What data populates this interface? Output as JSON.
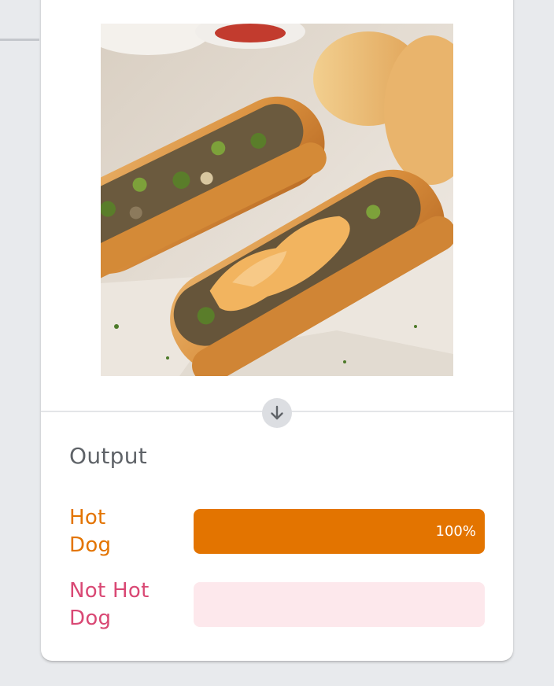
{
  "input": {
    "image_description": "cheesesteak-sandwiches-photo"
  },
  "output": {
    "title": "Output",
    "results": [
      {
        "label_line1": "Hot",
        "label_line2": "Dog",
        "confidence": 1.0,
        "confidence_text": "100%",
        "color": "#e37400",
        "track_color": "#fde7cc"
      },
      {
        "label_line1": "Not Hot",
        "label_line2": "Dog",
        "confidence": 0.0,
        "confidence_text": "",
        "color": "#d94874",
        "track_color": "#fde8ec"
      }
    ]
  },
  "icons": {
    "arrow": "arrow-down-icon"
  }
}
